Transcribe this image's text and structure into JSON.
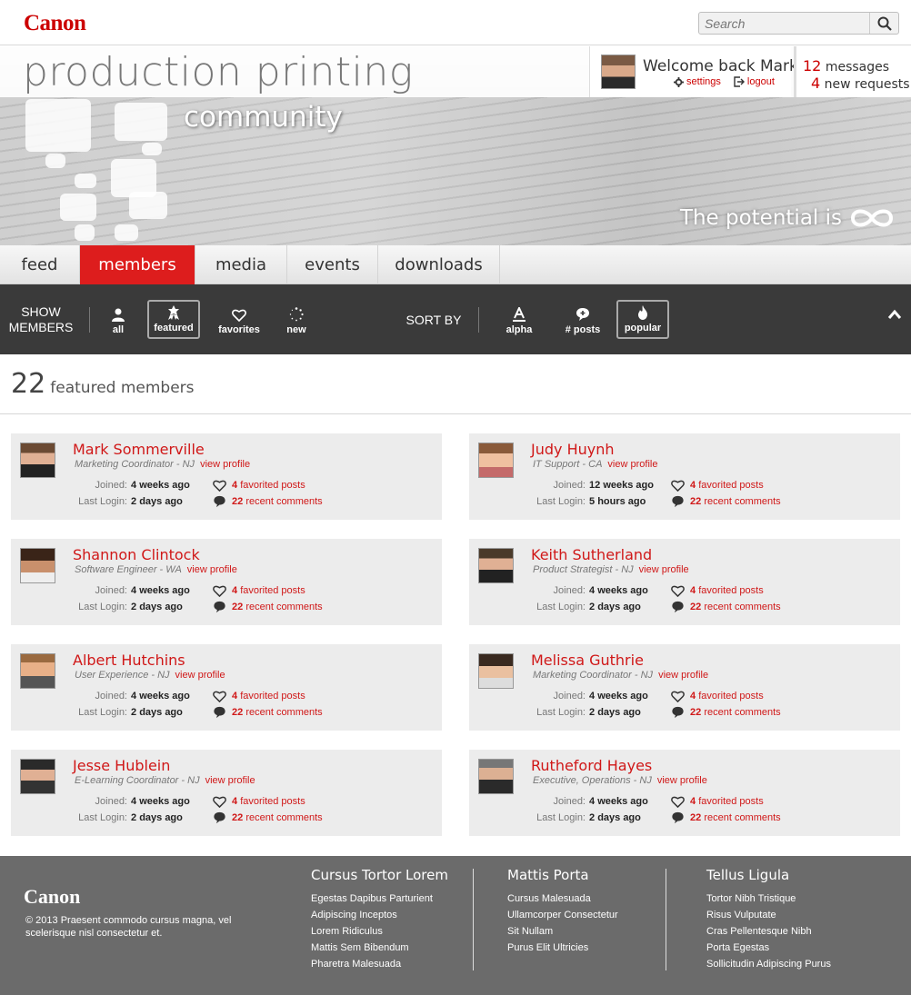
{
  "brand": {
    "logo": "Canon",
    "accent": "#cc0000"
  },
  "search": {
    "placeholder": "Search"
  },
  "hero": {
    "title": "production printing",
    "subtitle": "community",
    "tagline": "The potential is"
  },
  "user": {
    "welcome": "Welcome back Mark",
    "settings": "settings",
    "logout": "logout"
  },
  "notifications": {
    "messages_count": "12",
    "messages_label": "messages",
    "requests_count": "4",
    "requests_label": "new requests"
  },
  "tabs": [
    {
      "label": "feed"
    },
    {
      "label": "members"
    },
    {
      "label": "media"
    },
    {
      "label": "events"
    },
    {
      "label": "downloads"
    }
  ],
  "filters": {
    "show_label_1": "SHOW",
    "show_label_2": "MEMBERS",
    "show": [
      "all",
      "featured",
      "favorites",
      "new"
    ],
    "sort_label": "SORT BY",
    "sort": [
      "alpha",
      "# posts",
      "popular"
    ]
  },
  "summary": {
    "count": "22",
    "label": "featured members"
  },
  "members": [
    {
      "name": "Mark Sommerville",
      "role": "Marketing Coordinator - NJ",
      "view": "view profile",
      "joined_label": "Joined:",
      "joined_n": "4",
      "joined_unit": "weeks ago",
      "login_label": "Last Login:",
      "login_n": "2",
      "login_unit": "days ago",
      "fav_n": "4",
      "fav_label": "favorited posts",
      "comm_n": "22",
      "comm_label": "recent comments"
    },
    {
      "name": "Judy Huynh",
      "role": "IT Support - CA",
      "view": "view profile",
      "joined_label": "Joined:",
      "joined_n": "12",
      "joined_unit": "weeks ago",
      "login_label": "Last Login:",
      "login_n": "5",
      "login_unit": "hours ago",
      "fav_n": "4",
      "fav_label": "favorited posts",
      "comm_n": "22",
      "comm_label": "recent comments"
    },
    {
      "name": "Shannon Clintock",
      "role": "Software Engineer - WA",
      "view": "view profile",
      "joined_label": "Joined:",
      "joined_n": "4",
      "joined_unit": "weeks ago",
      "login_label": "Last Login:",
      "login_n": "2",
      "login_unit": "days ago",
      "fav_n": "4",
      "fav_label": "favorited posts",
      "comm_n": "22",
      "comm_label": "recent comments"
    },
    {
      "name": "Keith Sutherland",
      "role": "Product Strategist - NJ",
      "view": "view profile",
      "joined_label": "Joined:",
      "joined_n": "4",
      "joined_unit": "weeks ago",
      "login_label": "Last Login:",
      "login_n": "2",
      "login_unit": "days ago",
      "fav_n": "4",
      "fav_label": "favorited posts",
      "comm_n": "22",
      "comm_label": "recent comments"
    },
    {
      "name": "Albert Hutchins",
      "role": "User Experience - NJ",
      "view": "view profile",
      "joined_label": "Joined:",
      "joined_n": "4",
      "joined_unit": "weeks ago",
      "login_label": "Last Login:",
      "login_n": "2",
      "login_unit": "days ago",
      "fav_n": "4",
      "fav_label": "favorited posts",
      "comm_n": "22",
      "comm_label": "recent comments"
    },
    {
      "name": "Melissa Guthrie",
      "role": "Marketing Coordinator - NJ",
      "view": "view profile",
      "joined_label": "Joined:",
      "joined_n": "4",
      "joined_unit": "weeks ago",
      "login_label": "Last Login:",
      "login_n": "2",
      "login_unit": "days ago",
      "fav_n": "4",
      "fav_label": "favorited posts",
      "comm_n": "22",
      "comm_label": "recent comments"
    },
    {
      "name": "Jesse Hublein",
      "role": "E-Learning Coordinator - NJ",
      "view": "view profile",
      "joined_label": "Joined:",
      "joined_n": "4",
      "joined_unit": "weeks ago",
      "login_label": "Last Login:",
      "login_n": "2",
      "login_unit": "days ago",
      "fav_n": "4",
      "fav_label": "favorited posts",
      "comm_n": "22",
      "comm_label": "recent comments"
    },
    {
      "name": "Rutheford Hayes",
      "role": "Executive, Operations - NJ",
      "view": "view profile",
      "joined_label": "Joined:",
      "joined_n": "4",
      "joined_unit": "weeks ago",
      "login_label": "Last Login:",
      "login_n": "2",
      "login_unit": "days ago",
      "fav_n": "4",
      "fav_label": "favorited posts",
      "comm_n": "22",
      "comm_label": "recent comments"
    }
  ],
  "footer": {
    "logo": "Canon",
    "copyright": "© 2013 Praesent commodo cursus magna, vel scelerisque nisl consectetur et.",
    "columns": [
      {
        "title": "Cursus Tortor Lorem",
        "links": [
          "Egestas Dapibus Parturient",
          "Adipiscing Inceptos",
          "Lorem Ridiculus",
          "Mattis Sem Bibendum",
          "Pharetra Malesuada"
        ]
      },
      {
        "title": "Mattis Porta",
        "links": [
          "Cursus Malesuada",
          "Ullamcorper Consectetur",
          "Sit Nullam",
          "Purus Elit Ultricies"
        ]
      },
      {
        "title": "Tellus Ligula",
        "links": [
          "Tortor Nibh Tristique",
          "Risus Vulputate",
          "Cras Pellentesque Nibh",
          "Porta Egestas",
          "Sollicitudin Adipiscing Purus"
        ]
      }
    ]
  }
}
